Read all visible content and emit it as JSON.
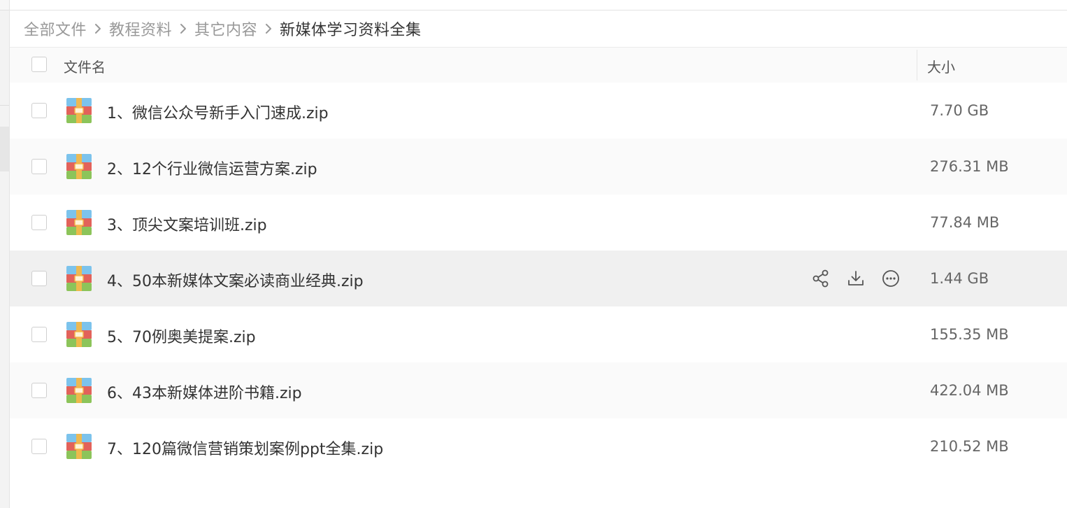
{
  "breadcrumb": {
    "items": [
      "全部文件",
      "教程资料",
      "其它内容",
      "新媒体学习资料全集"
    ]
  },
  "table": {
    "columns": {
      "name": "文件名",
      "size": "大小"
    },
    "files": [
      {
        "name": "1、微信公众号新手入门速成.zip",
        "size": "7.70 GB",
        "icon": "zip-archive-icon"
      },
      {
        "name": "2、12个行业微信运营方案.zip",
        "size": "276.31 MB",
        "icon": "zip-archive-icon"
      },
      {
        "name": "3、顶尖文案培训班.zip",
        "size": "77.84 MB",
        "icon": "zip-archive-icon"
      },
      {
        "name": "4、50本新媒体文案必读商业经典.zip",
        "size": "1.44 GB",
        "icon": "zip-archive-icon",
        "hovered": true,
        "actions": [
          "share-icon",
          "download-icon",
          "more-icon"
        ]
      },
      {
        "name": "5、70例奥美提案.zip",
        "size": "155.35 MB",
        "icon": "zip-archive-icon"
      },
      {
        "name": "6、43本新媒体进阶书籍.zip",
        "size": "422.04 MB",
        "icon": "zip-archive-icon"
      },
      {
        "name": "7、120篇微信营销策划案例ppt全集.zip",
        "size": "210.52 MB",
        "icon": "zip-archive-icon"
      }
    ]
  },
  "colors": {
    "hover_row": "#f0f0f0",
    "alt_row": "#fafafa",
    "zip_blue": "#7cc3ec",
    "zip_red": "#e2625a",
    "zip_green": "#8cc45a",
    "zip_clasp": "#f2b84b"
  }
}
